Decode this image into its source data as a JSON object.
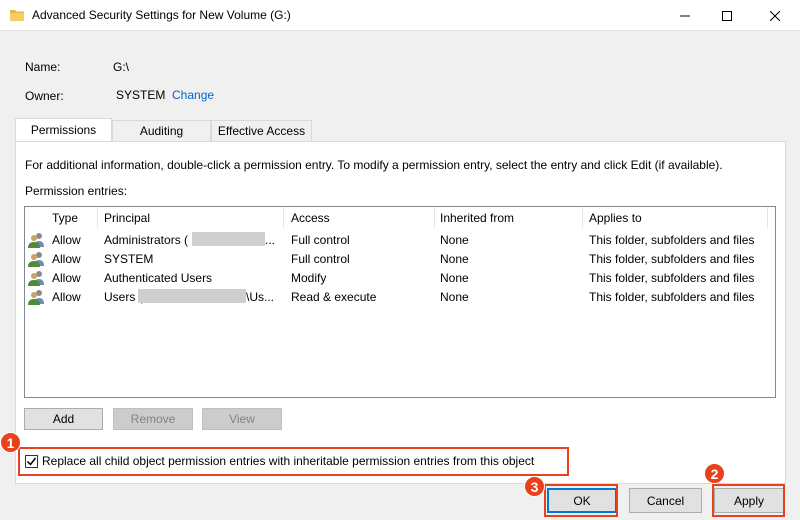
{
  "window": {
    "title": "Advanced Security Settings for New Volume (G:)"
  },
  "info": {
    "name_label": "Name:",
    "name_value": "G:\\",
    "owner_label": "Owner:",
    "owner_value": "SYSTEM",
    "change_link": "Change"
  },
  "tabs": [
    {
      "label": "Permissions",
      "active": true
    },
    {
      "label": "Auditing",
      "active": false
    },
    {
      "label": "Effective Access",
      "active": false
    }
  ],
  "permissions": {
    "hint": "For additional information, double-click a permission entry. To modify a permission entry, select the entry and click Edit (if available).",
    "entries_label": "Permission entries:",
    "columns": [
      "Type",
      "Principal",
      "Access",
      "Inherited from",
      "Applies to"
    ],
    "rows": [
      {
        "type": "Allow",
        "principal": "Administrators (",
        "access": "Full control",
        "inherited": "None",
        "applies": "This folder, subfolders and files"
      },
      {
        "type": "Allow",
        "principal": "SYSTEM",
        "access": "Full control",
        "inherited": "None",
        "applies": "This folder, subfolders and files"
      },
      {
        "type": "Allow",
        "principal": "Authenticated Users",
        "access": "Modify",
        "inherited": "None",
        "applies": "This folder, subfolders and files"
      },
      {
        "type": "Allow",
        "principal": "Users (",
        "principal_suffix": "\\Us...",
        "access": "Read & execute",
        "inherited": "None",
        "applies": "This folder, subfolders and files"
      }
    ]
  },
  "buttons": {
    "add": "Add",
    "remove": "Remove",
    "view": "View",
    "ok": "OK",
    "cancel": "Cancel",
    "apply": "Apply"
  },
  "checkbox": {
    "label": "Replace all child object permission entries with inheritable permission entries from this object",
    "checked": true
  },
  "badges": {
    "checkbox": "1",
    "apply": "2",
    "ok": "3"
  },
  "colors": {
    "highlight": "#e8411c",
    "link": "#0066cc",
    "default_button_border": "#0078d7"
  }
}
